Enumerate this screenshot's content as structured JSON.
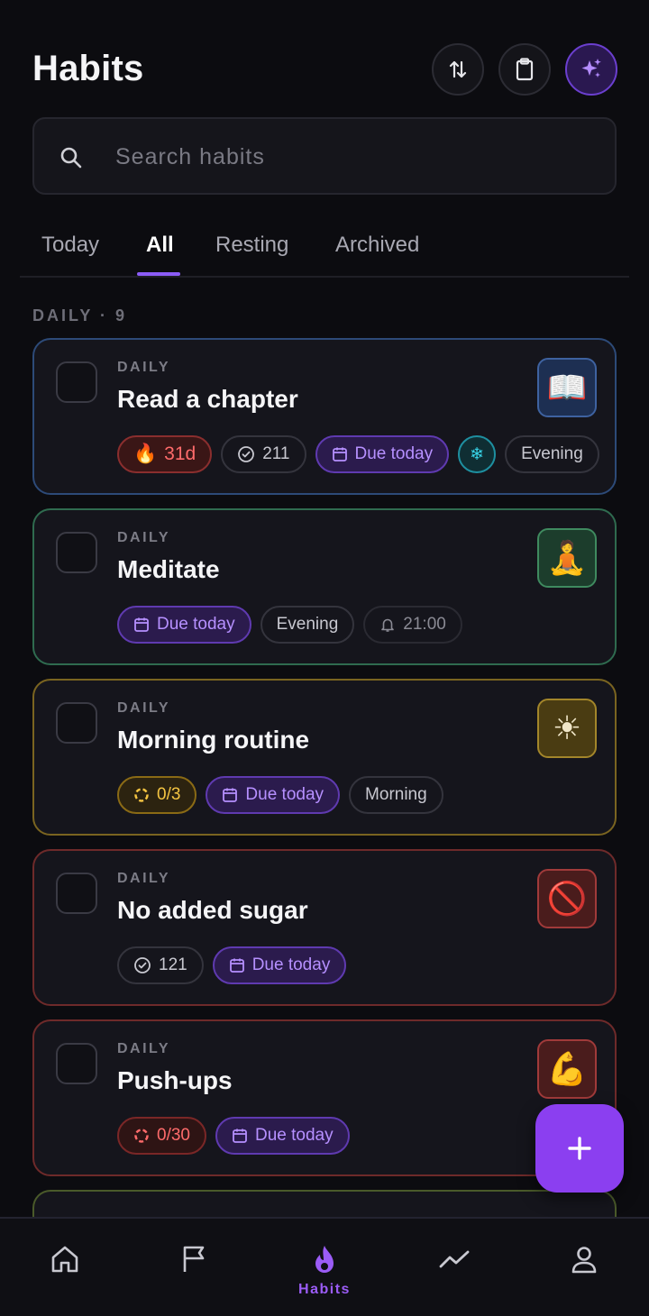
{
  "header": {
    "title": "Habits",
    "sort_icon": "sort-arrows-icon",
    "clipboard_icon": "clipboard-icon",
    "ai_icon": "sparkles-icon"
  },
  "search": {
    "placeholder": "Search habits",
    "value": ""
  },
  "tabs": [
    {
      "label": "Today",
      "active": false
    },
    {
      "label": "All",
      "active": true
    },
    {
      "label": "Resting",
      "active": false
    },
    {
      "label": "Archived",
      "active": false
    }
  ],
  "section": {
    "label": "DAILY · 9"
  },
  "habits": [
    {
      "frequency": "DAILY",
      "name": "Read a chapter",
      "emoji": "📖",
      "accent": "#2d4a78",
      "streak": "31d",
      "completions": "211",
      "due": "Due today",
      "freeze_icon": "❄",
      "time_of_day": "Evening"
    },
    {
      "frequency": "DAILY",
      "name": "Meditate",
      "emoji": "🧘",
      "accent": "#2f6b4f",
      "due": "Due today",
      "time_of_day": "Evening",
      "reminder": "21:00"
    },
    {
      "frequency": "DAILY",
      "name": "Morning routine",
      "emoji": "☀",
      "accent": "#7a6420",
      "progress": "0/3",
      "due": "Due today",
      "time_of_day": "Morning"
    },
    {
      "frequency": "DAILY",
      "name": "No added sugar",
      "emoji": "🚫",
      "accent": "#6e2a2a",
      "completions": "121",
      "due": "Due today"
    },
    {
      "frequency": "DAILY",
      "name": "Push-ups",
      "emoji": "💪",
      "accent": "#6e2a2a",
      "progress": "0/30",
      "due": "Due today"
    }
  ],
  "fab": {
    "icon": "plus-icon"
  },
  "bottom_nav": [
    {
      "icon": "home-icon",
      "label": ""
    },
    {
      "icon": "flag-icon",
      "label": ""
    },
    {
      "icon": "flame-icon",
      "label": "Habits",
      "active": true
    },
    {
      "icon": "trend-icon",
      "label": ""
    },
    {
      "icon": "profile-icon",
      "label": ""
    }
  ],
  "colors": {
    "accent": "#8b5cf6",
    "background": "#0c0c10",
    "card": "#15151c"
  }
}
